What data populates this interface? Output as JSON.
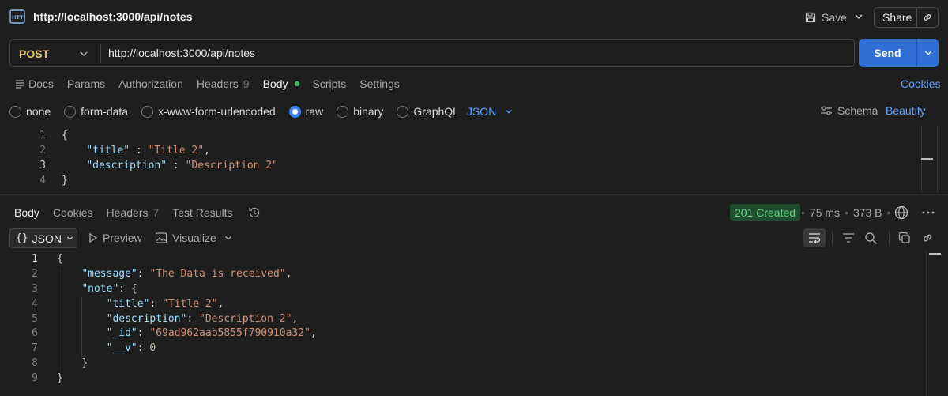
{
  "top": {
    "title": "http://localhost:3000/api/notes",
    "save_label": "Save",
    "share_label": "Share"
  },
  "request": {
    "method": "POST",
    "url": "http://localhost:3000/api/notes",
    "send_label": "Send"
  },
  "request_tabs": {
    "docs": "Docs",
    "params": "Params",
    "authorization": "Authorization",
    "headers": "Headers",
    "headers_count": "9",
    "body": "Body",
    "scripts": "Scripts",
    "settings": "Settings",
    "cookies": "Cookies"
  },
  "body_types": {
    "none": "none",
    "form_data": "form-data",
    "urlencoded": "x-www-form-urlencoded",
    "raw": "raw",
    "binary": "binary",
    "graphql": "GraphQL",
    "language": "JSON",
    "schema": "Schema",
    "beautify": "Beautify"
  },
  "request_body": {
    "line_numbers": [
      "1",
      "2",
      "3",
      "4"
    ],
    "open_brace": "{",
    "close_brace": "}",
    "title_key": "\"title\"",
    "title_value": "\"Title 2\"",
    "description_key": "\"description\"",
    "description_value": "\"Description 2\""
  },
  "response_tabs": {
    "body": "Body",
    "cookies": "Cookies",
    "headers": "Headers",
    "headers_count": "7",
    "test_results": "Test Results"
  },
  "response_meta": {
    "status": "201 Created",
    "time": "75 ms",
    "size": "373 B"
  },
  "response_toolbar": {
    "format": "JSON",
    "preview": "Preview",
    "visualize": "Visualize"
  },
  "response_body": {
    "line_numbers": [
      "1",
      "2",
      "3",
      "4",
      "5",
      "6",
      "7",
      "8",
      "9"
    ],
    "open_brace": "{",
    "close_brace": "}",
    "message_key": "\"message\"",
    "message_value": "\"The Data is received\"",
    "note_key": "\"note\"",
    "title_key": "\"title\"",
    "title_value": "\"Title 2\"",
    "description_key": "\"description\"",
    "description_value": "\"Description 2\"",
    "id_key": "\"_id\"",
    "id_value": "\"69ad962aab5855f790910a32\"",
    "v_key": "\"__v\"",
    "v_value": "0"
  },
  "colors": {
    "accent_blue": "#2f6fd6",
    "method_yellow": "#e9c46a",
    "status_green": "#62d681",
    "json_key": "#9cdcfe",
    "json_string": "#ce9178"
  }
}
